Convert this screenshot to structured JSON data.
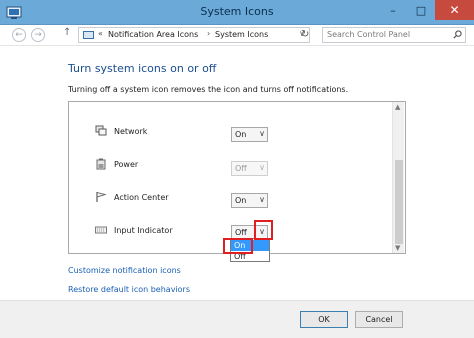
{
  "window": {
    "title": "System Icons",
    "controls": {
      "minimize": "–",
      "maximize": "□",
      "close": "✕"
    }
  },
  "nav": {
    "back": "←",
    "forward": "→",
    "up": "↑",
    "sep1": "«",
    "crumbs": [
      "Notification Area Icons",
      "System Icons"
    ],
    "sep2": "›",
    "dropdown": "∨",
    "refresh": "↻",
    "search_placeholder": "Search Control Panel"
  },
  "content": {
    "heading": "Turn system icons on or off",
    "description": "Turning off a system icon removes the icon and turns off notifications.",
    "rows": [
      {
        "label": "Network",
        "value": "On",
        "icon": "network-icon",
        "enabled": true
      },
      {
        "label": "Power",
        "value": "Off",
        "icon": "power-icon",
        "enabled": false
      },
      {
        "label": "Action Center",
        "value": "On",
        "icon": "flag-icon",
        "enabled": true
      },
      {
        "label": "Input Indicator",
        "value": "Off",
        "icon": "keyboard-icon",
        "enabled": true
      }
    ],
    "select_arrow": "∨",
    "dropdown_options": [
      "On",
      "Off"
    ],
    "links": [
      "Customize notification icons",
      "Restore default icon behaviors"
    ]
  },
  "buttons": {
    "ok": "OK",
    "cancel": "Cancel"
  },
  "scroll": {
    "up": "▲",
    "down": "▼"
  },
  "colors": {
    "titlebar": "#6aa9d8",
    "highlight": "#e02020",
    "link": "#1a5fb4",
    "heading": "#1c4f8f",
    "selected_option": "#3399ff"
  }
}
